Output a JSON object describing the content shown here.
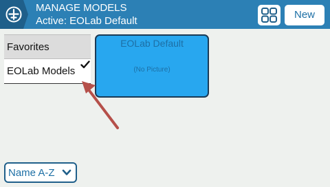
{
  "header": {
    "title": "MANAGE MODELS",
    "subtitle": "Active: EOLab Default",
    "new_button_label": "New"
  },
  "categories": [
    {
      "label": "Favorites",
      "selected": false
    },
    {
      "label": "EOLab Models",
      "selected": true
    }
  ],
  "models": [
    {
      "name": "EOLab Default",
      "picture_placeholder": "(No Picture)"
    }
  ],
  "sort": {
    "selected": "Name A-Z"
  },
  "colors": {
    "header_bg": "#2c80b5",
    "header_icon_bg": "#1f5f8a",
    "tile_bg": "#28a7ef",
    "text_accent": "#1d6fa5",
    "arrow": "#b5504a"
  },
  "icons": [
    "airplane-icon",
    "grid-view-icon",
    "checkmark-icon",
    "chevron-down-icon",
    "annotation-arrow"
  ]
}
